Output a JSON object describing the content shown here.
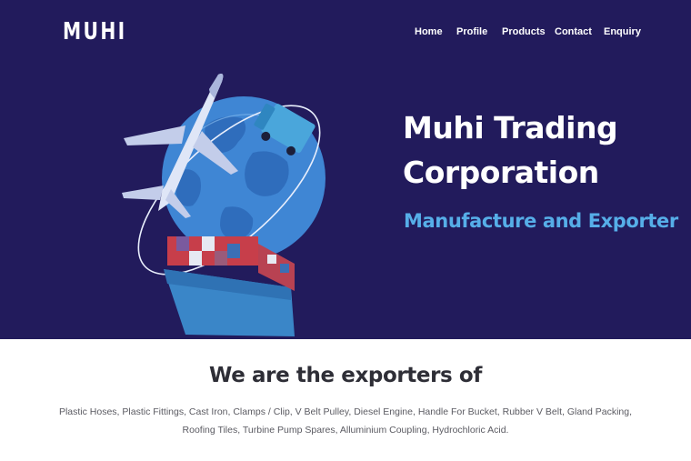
{
  "brand": {
    "logo": "MUHI"
  },
  "nav": {
    "items": [
      "Home",
      "Profile",
      "Products",
      "Contact",
      "Enquiry"
    ]
  },
  "hero": {
    "title_line1": "Muhi Trading",
    "title_line2": "Corporation",
    "subtitle": "Manufacture and Exporter"
  },
  "exporters": {
    "heading": "We are the exporters of",
    "products_text": "Plastic Hoses, Plastic Fittings, Cast Iron, Clamps / Clip, V Belt Pulley, Diesel Engine, Handle For Bucket, Rubber V Belt, Gland Packing, Roofing Tiles, Turbine Pump Spares, Alluminium Coupling, Hydrochloric Acid."
  },
  "colors": {
    "hero_background": "#221b5c",
    "accent_blue": "#56aee8",
    "heading_dark": "#2e2e36"
  },
  "icons": {
    "illustration": "globe-plane-ship-truck-illustration"
  }
}
